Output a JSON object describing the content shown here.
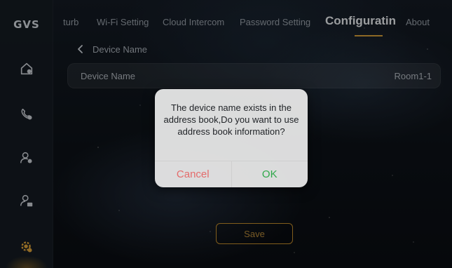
{
  "brand": {
    "logo_text": "GVS"
  },
  "colors": {
    "accent": "#d9a23a",
    "cancel": "#e46b6b",
    "ok": "#2fa84a"
  },
  "sidebar": {
    "items": [
      {
        "icon": "home-icon"
      },
      {
        "icon": "phone-call-icon"
      },
      {
        "icon": "user-settings-icon"
      },
      {
        "icon": "user-lock-icon"
      },
      {
        "icon": "gear-user-icon",
        "active": true
      }
    ]
  },
  "tabs": [
    {
      "label": "turb"
    },
    {
      "label": "Wi-Fi Setting"
    },
    {
      "label": "Cloud Intercom"
    },
    {
      "label": "Password Setting"
    },
    {
      "label": "Configuratin",
      "active": true
    },
    {
      "label": "About"
    }
  ],
  "breadcrumb": {
    "back_label": "Device Name"
  },
  "field": {
    "label": "Device Name",
    "value": "Room1-1"
  },
  "save_label": "Save",
  "dialog": {
    "message": "The device name exists in the address book,Do you want to use address book information?",
    "cancel_label": "Cancel",
    "ok_label": "OK"
  }
}
